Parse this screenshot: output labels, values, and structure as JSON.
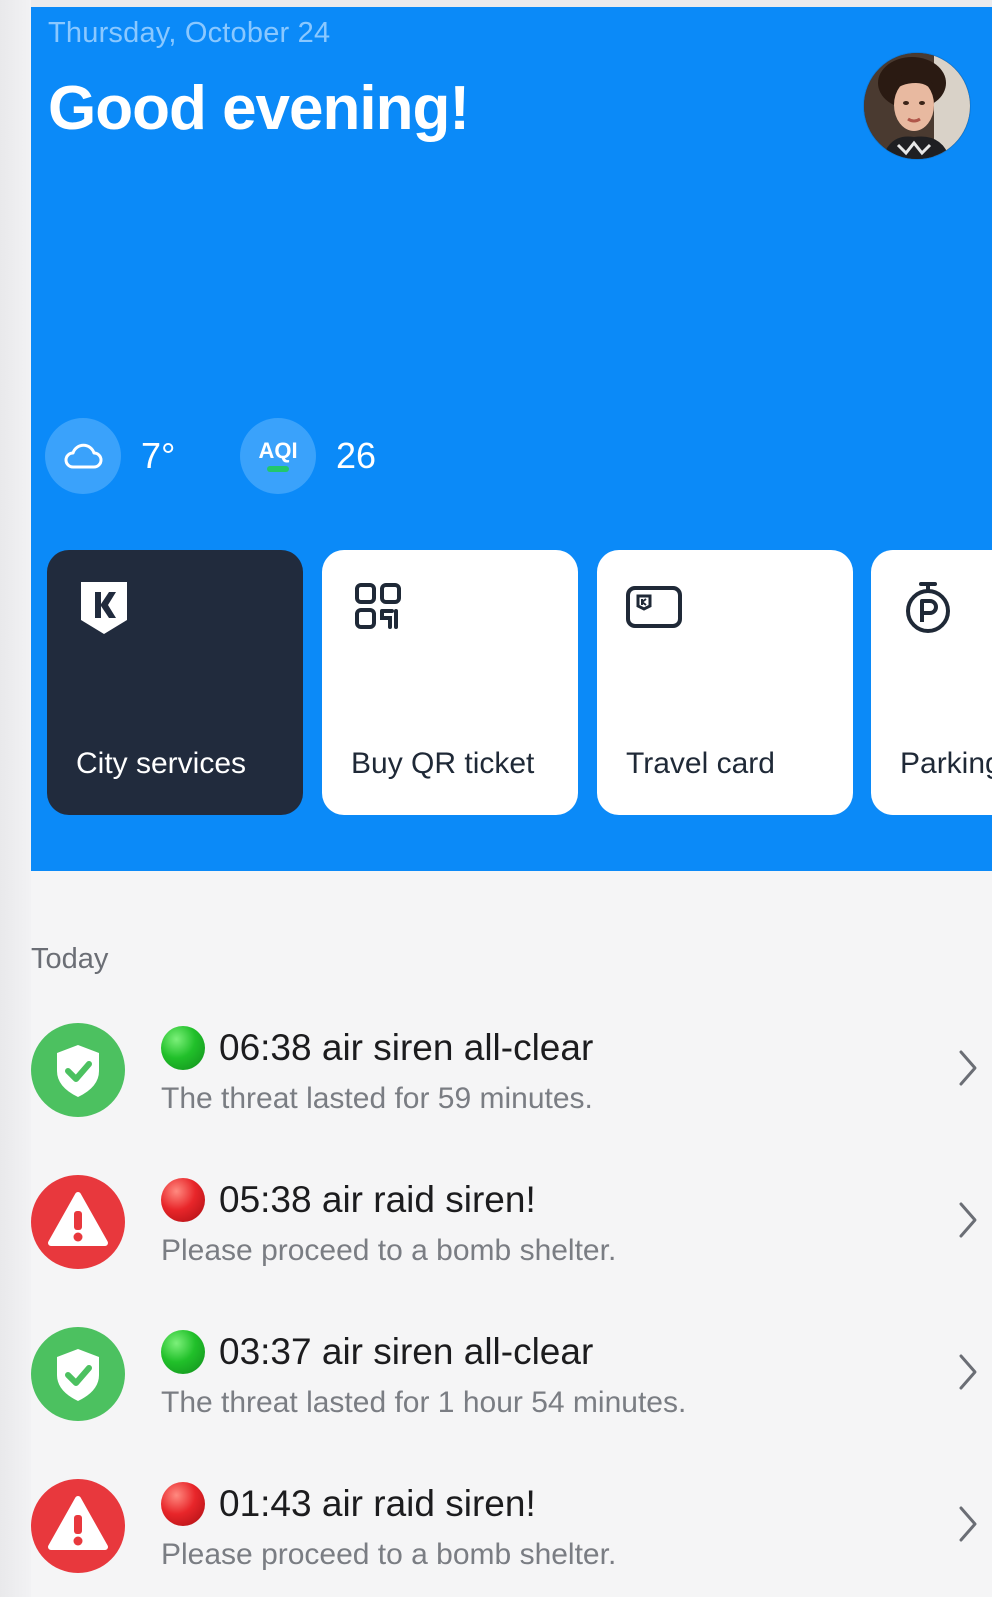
{
  "header": {
    "date": "Thursday, October 24",
    "greeting": "Good evening!"
  },
  "weather": {
    "icon": "cloud-icon",
    "temperature": "7°"
  },
  "air_quality": {
    "label": "AQI",
    "value": "26",
    "indicator_color": "#22c76b"
  },
  "quick_actions": [
    {
      "label": "City services",
      "icon": "kyiv-shield-icon"
    },
    {
      "label": "Buy QR ticket",
      "icon": "qr-code-icon"
    },
    {
      "label": "Travel card",
      "icon": "travel-card-icon"
    },
    {
      "label": "Parking",
      "icon": "parking-timer-icon"
    }
  ],
  "notifications": {
    "section_title": "Today",
    "items": [
      {
        "type": "all-clear",
        "title": "06:38 air siren all-clear",
        "subtitle": "The threat lasted for 59 minutes."
      },
      {
        "type": "alert",
        "title": "05:38 air raid siren!",
        "subtitle": "Please proceed to a bomb shelter."
      },
      {
        "type": "all-clear",
        "title": "03:37 air siren all-clear",
        "subtitle": "The threat lasted for 1 hour 54 minutes."
      },
      {
        "type": "alert",
        "title": "01:43 air raid siren!",
        "subtitle": "Please proceed to a bomb shelter."
      }
    ]
  },
  "colors": {
    "hero_blue": "#0b8af8",
    "dark_tile": "#212b3d",
    "shield_green": "#4cc160",
    "alert_red": "#e8383d"
  }
}
